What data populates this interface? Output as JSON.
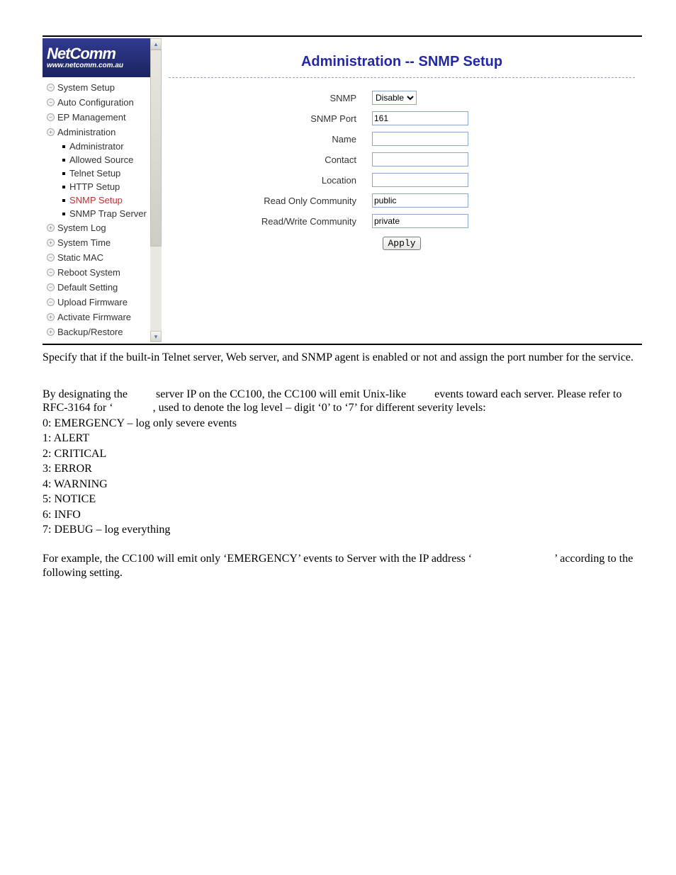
{
  "logo": {
    "brand": "NetComm",
    "url": "www.netcomm.com.au"
  },
  "sidebar": {
    "items": [
      {
        "label": "System Setup",
        "icon": "−"
      },
      {
        "label": "Auto Configuration",
        "icon": "−"
      },
      {
        "label": "EP Management",
        "icon": "−"
      },
      {
        "label": "Administration",
        "icon": "+"
      },
      {
        "label": "System Log",
        "icon": "+"
      },
      {
        "label": "System Time",
        "icon": "+"
      },
      {
        "label": "Static MAC",
        "icon": "−"
      },
      {
        "label": "Reboot System",
        "icon": "−"
      },
      {
        "label": "Default Setting",
        "icon": "−"
      },
      {
        "label": "Upload Firmware",
        "icon": "−"
      },
      {
        "label": "Activate Firmware",
        "icon": "+"
      },
      {
        "label": "Backup/Restore",
        "icon": "+"
      }
    ],
    "admin_sub": [
      "Administrator",
      "Allowed Source",
      "Telnet Setup",
      "HTTP Setup",
      "SNMP Setup",
      "SNMP Trap Server"
    ]
  },
  "main": {
    "title": "Administration -- SNMP Setup",
    "fields": {
      "snmp_label": "SNMP",
      "snmp_value": "Disable",
      "port_label": "SNMP Port",
      "port_value": "161",
      "name_label": "Name",
      "name_value": "",
      "contact_label": "Contact",
      "contact_value": "",
      "location_label": "Location",
      "location_value": "",
      "ro_label": "Read Only Community",
      "ro_value": "public",
      "rw_label": "Read/Write Community",
      "rw_value": "private"
    },
    "apply": "Apply"
  },
  "doc": {
    "p1": "Specify that if the built-in Telnet server, Web server, and SNMP agent is enabled or not and assign the port number for the service.",
    "p2a": "By designating the ",
    "p2b": " server IP on the CC100, the CC100 will emit Unix-like ",
    "p2c": " events toward each server. Please refer to RFC-3164 for ",
    "p2d": "‘",
    "p2e": ", used to denote the log level – digit ‘0’ to ‘7’ for different severity levels:",
    "lv0": "0: EMERGENCY – log only severe events",
    "lv1": "1: ALERT",
    "lv2": "2: CRITICAL",
    "lv3": "3: ERROR",
    "lv4": "4: WARNING",
    "lv5": "5: NOTICE",
    "lv6": "6: INFO",
    "lv7": "7: DEBUG – log everything",
    "p3a": "For example, the CC100 will emit only ‘EMERGENCY’ events to Server with the IP address ‘",
    "p3b": "’ according to the following setting."
  }
}
